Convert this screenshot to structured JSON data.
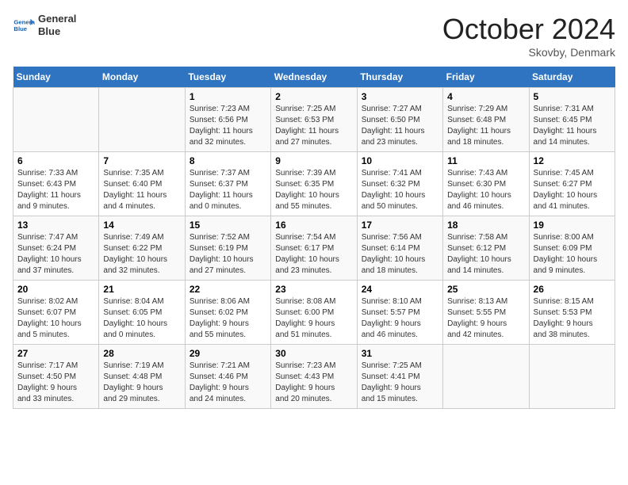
{
  "header": {
    "logo_line1": "General",
    "logo_line2": "Blue",
    "month_title": "October 2024",
    "location": "Skovby, Denmark"
  },
  "weekdays": [
    "Sunday",
    "Monday",
    "Tuesday",
    "Wednesday",
    "Thursday",
    "Friday",
    "Saturday"
  ],
  "weeks": [
    [
      {
        "day": "",
        "info": ""
      },
      {
        "day": "",
        "info": ""
      },
      {
        "day": "1",
        "info": "Sunrise: 7:23 AM\nSunset: 6:56 PM\nDaylight: 11 hours\nand 32 minutes."
      },
      {
        "day": "2",
        "info": "Sunrise: 7:25 AM\nSunset: 6:53 PM\nDaylight: 11 hours\nand 27 minutes."
      },
      {
        "day": "3",
        "info": "Sunrise: 7:27 AM\nSunset: 6:50 PM\nDaylight: 11 hours\nand 23 minutes."
      },
      {
        "day": "4",
        "info": "Sunrise: 7:29 AM\nSunset: 6:48 PM\nDaylight: 11 hours\nand 18 minutes."
      },
      {
        "day": "5",
        "info": "Sunrise: 7:31 AM\nSunset: 6:45 PM\nDaylight: 11 hours\nand 14 minutes."
      }
    ],
    [
      {
        "day": "6",
        "info": "Sunrise: 7:33 AM\nSunset: 6:43 PM\nDaylight: 11 hours\nand 9 minutes."
      },
      {
        "day": "7",
        "info": "Sunrise: 7:35 AM\nSunset: 6:40 PM\nDaylight: 11 hours\nand 4 minutes."
      },
      {
        "day": "8",
        "info": "Sunrise: 7:37 AM\nSunset: 6:37 PM\nDaylight: 11 hours\nand 0 minutes."
      },
      {
        "day": "9",
        "info": "Sunrise: 7:39 AM\nSunset: 6:35 PM\nDaylight: 10 hours\nand 55 minutes."
      },
      {
        "day": "10",
        "info": "Sunrise: 7:41 AM\nSunset: 6:32 PM\nDaylight: 10 hours\nand 50 minutes."
      },
      {
        "day": "11",
        "info": "Sunrise: 7:43 AM\nSunset: 6:30 PM\nDaylight: 10 hours\nand 46 minutes."
      },
      {
        "day": "12",
        "info": "Sunrise: 7:45 AM\nSunset: 6:27 PM\nDaylight: 10 hours\nand 41 minutes."
      }
    ],
    [
      {
        "day": "13",
        "info": "Sunrise: 7:47 AM\nSunset: 6:24 PM\nDaylight: 10 hours\nand 37 minutes."
      },
      {
        "day": "14",
        "info": "Sunrise: 7:49 AM\nSunset: 6:22 PM\nDaylight: 10 hours\nand 32 minutes."
      },
      {
        "day": "15",
        "info": "Sunrise: 7:52 AM\nSunset: 6:19 PM\nDaylight: 10 hours\nand 27 minutes."
      },
      {
        "day": "16",
        "info": "Sunrise: 7:54 AM\nSunset: 6:17 PM\nDaylight: 10 hours\nand 23 minutes."
      },
      {
        "day": "17",
        "info": "Sunrise: 7:56 AM\nSunset: 6:14 PM\nDaylight: 10 hours\nand 18 minutes."
      },
      {
        "day": "18",
        "info": "Sunrise: 7:58 AM\nSunset: 6:12 PM\nDaylight: 10 hours\nand 14 minutes."
      },
      {
        "day": "19",
        "info": "Sunrise: 8:00 AM\nSunset: 6:09 PM\nDaylight: 10 hours\nand 9 minutes."
      }
    ],
    [
      {
        "day": "20",
        "info": "Sunrise: 8:02 AM\nSunset: 6:07 PM\nDaylight: 10 hours\nand 5 minutes."
      },
      {
        "day": "21",
        "info": "Sunrise: 8:04 AM\nSunset: 6:05 PM\nDaylight: 10 hours\nand 0 minutes."
      },
      {
        "day": "22",
        "info": "Sunrise: 8:06 AM\nSunset: 6:02 PM\nDaylight: 9 hours\nand 55 minutes."
      },
      {
        "day": "23",
        "info": "Sunrise: 8:08 AM\nSunset: 6:00 PM\nDaylight: 9 hours\nand 51 minutes."
      },
      {
        "day": "24",
        "info": "Sunrise: 8:10 AM\nSunset: 5:57 PM\nDaylight: 9 hours\nand 46 minutes."
      },
      {
        "day": "25",
        "info": "Sunrise: 8:13 AM\nSunset: 5:55 PM\nDaylight: 9 hours\nand 42 minutes."
      },
      {
        "day": "26",
        "info": "Sunrise: 8:15 AM\nSunset: 5:53 PM\nDaylight: 9 hours\nand 38 minutes."
      }
    ],
    [
      {
        "day": "27",
        "info": "Sunrise: 7:17 AM\nSunset: 4:50 PM\nDaylight: 9 hours\nand 33 minutes."
      },
      {
        "day": "28",
        "info": "Sunrise: 7:19 AM\nSunset: 4:48 PM\nDaylight: 9 hours\nand 29 minutes."
      },
      {
        "day": "29",
        "info": "Sunrise: 7:21 AM\nSunset: 4:46 PM\nDaylight: 9 hours\nand 24 minutes."
      },
      {
        "day": "30",
        "info": "Sunrise: 7:23 AM\nSunset: 4:43 PM\nDaylight: 9 hours\nand 20 minutes."
      },
      {
        "day": "31",
        "info": "Sunrise: 7:25 AM\nSunset: 4:41 PM\nDaylight: 9 hours\nand 15 minutes."
      },
      {
        "day": "",
        "info": ""
      },
      {
        "day": "",
        "info": ""
      }
    ]
  ]
}
